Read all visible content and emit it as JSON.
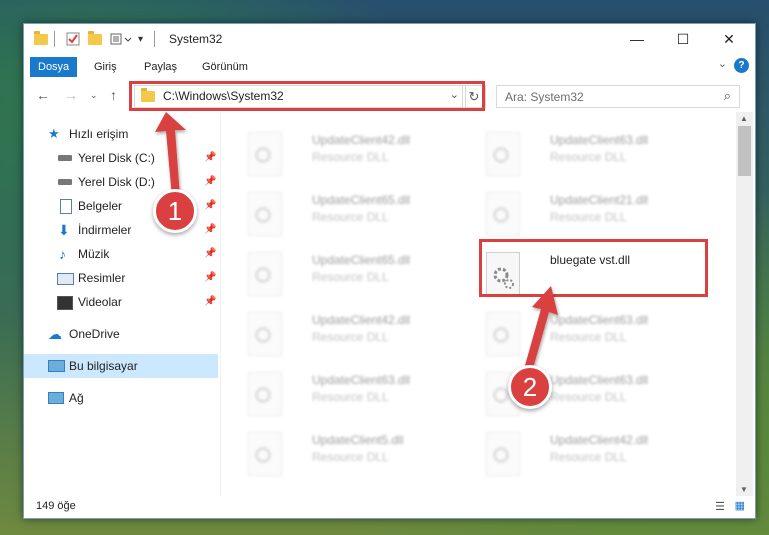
{
  "window": {
    "title": "System32",
    "minimize": "—",
    "maximize": "☐",
    "close": "✕"
  },
  "ribbon": {
    "tabs": [
      "Dosya",
      "Giriş",
      "Paylaş",
      "Görünüm"
    ],
    "help": "?"
  },
  "address": {
    "path": "C:\\Windows\\System32",
    "search_placeholder": "Ara: System32"
  },
  "nav": {
    "quick_access": "Hızlı erişim",
    "items": [
      "Yerel Disk (C:)",
      "Yerel Disk (D:)",
      "Belgeler",
      "İndirmeler",
      "Müzik",
      "Resimler",
      "Videolar"
    ],
    "onedrive": "OneDrive",
    "this_pc": "Bu bilgisayar",
    "network": "Ağ"
  },
  "files": [
    {
      "name": "UpdateClient42.dll",
      "type": "Resource DLL"
    },
    {
      "name": "UpdateClient63.dll",
      "type": "Resource DLL"
    },
    {
      "name": "UpdateClient65.dll",
      "type": "Resource DLL"
    },
    {
      "name": "UpdateClient21.dll",
      "type": "Resource DLL"
    },
    {
      "name": "UpdateClient65.dll",
      "type": "Resource DLL"
    },
    {
      "name": "bluegate vst.dll",
      "type": ""
    },
    {
      "name": "UpdateClient42.dll",
      "type": "Resource DLL"
    },
    {
      "name": "UpdateClient63.dll",
      "type": "Resource DLL"
    },
    {
      "name": "UpdateClient63.dll",
      "type": "Resource DLL"
    },
    {
      "name": "UpdateClient63.dll",
      "type": "Resource DLL"
    },
    {
      "name": "UpdateClient5.dll",
      "type": "Resource DLL"
    },
    {
      "name": "UpdateClient42.dll",
      "type": "Resource DLL"
    }
  ],
  "status": {
    "count": "149 öğe"
  },
  "annotations": {
    "step1": "1",
    "step2": "2",
    "color": "#d9403f"
  }
}
